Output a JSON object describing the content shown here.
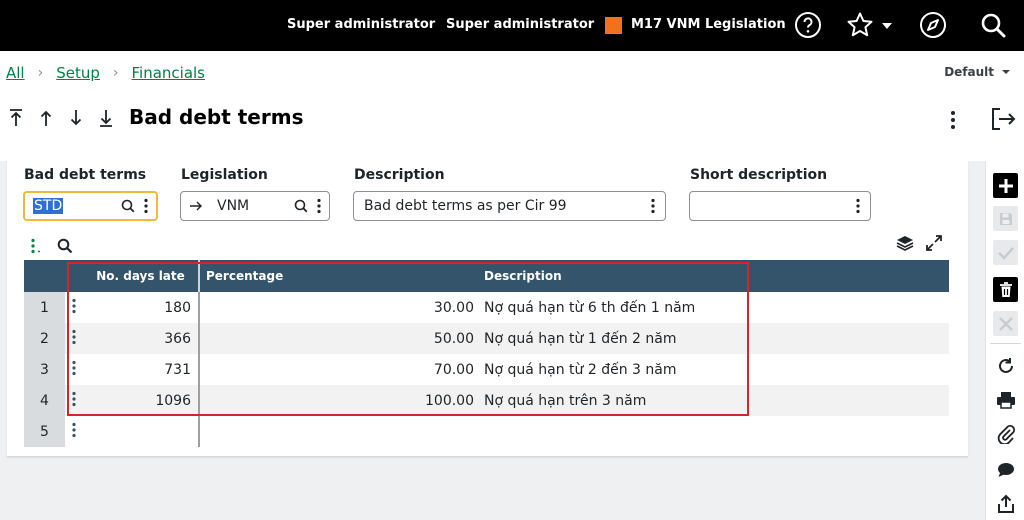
{
  "topbar": {
    "user_primary": "Super administrator",
    "user_secondary": "Super administrator",
    "legislation": "M17 VNM Legislation",
    "legislation_color": "#f2711c",
    "icons": [
      "help-icon",
      "star-icon",
      "chevron-down-icon",
      "compass-icon",
      "search-icon"
    ]
  },
  "breadcrumb": {
    "items": [
      "All",
      "Setup",
      "Financials"
    ]
  },
  "header": {
    "view_selector": "Default",
    "title": "Bad debt terms"
  },
  "form": {
    "bad_debt_terms": {
      "label": "Bad debt terms",
      "value": "STD"
    },
    "legislation": {
      "label": "Legislation",
      "value": "VNM"
    },
    "description": {
      "label": "Description",
      "value": "Bad debt terms as per Cir 99"
    },
    "short_description": {
      "label": "Short description",
      "value": ""
    }
  },
  "table": {
    "columns": [
      "No. days late",
      "Percentage",
      "Description"
    ],
    "rows": [
      {
        "num": "1",
        "days": "180",
        "percentage": "30.00",
        "description": "Nợ quá hạn từ 6 th đến 1 năm"
      },
      {
        "num": "2",
        "days": "366",
        "percentage": "50.00",
        "description": "Nợ quá hạn từ 1 đến 2 năm"
      },
      {
        "num": "3",
        "days": "731",
        "percentage": "70.00",
        "description": "Nợ quá hạn từ 2 đến 3 năm"
      },
      {
        "num": "4",
        "days": "1096",
        "percentage": "100.00",
        "description": "Nợ quá hạn trên 3 năm"
      },
      {
        "num": "5",
        "days": "",
        "percentage": "",
        "description": ""
      }
    ],
    "header_color": "#33546a",
    "highlight_color": "#d8232a"
  }
}
